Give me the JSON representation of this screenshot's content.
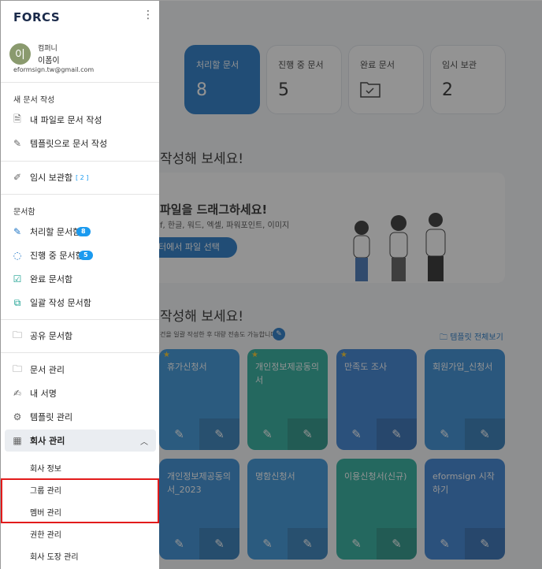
{
  "summary_cards": [
    {
      "label": "처리할 문서",
      "value": "8",
      "active": true
    },
    {
      "label": "진행 중 문서",
      "value": "5",
      "active": false
    },
    {
      "label": "완료 문서",
      "value": "",
      "icon": "folder-check-icon",
      "active": false
    },
    {
      "label": "임시 보관",
      "value": "2",
      "active": false
    }
  ],
  "upload": {
    "heading": "작성해 보세요!",
    "drag_title": "파일을 드래그하세요!",
    "formats": "f, 한글, 워드, 엑셀, 파워포인트, 이미지",
    "button": "터에서 파일 선택"
  },
  "templates": {
    "heading": "작성해 보세요!",
    "note": "건을 일괄 작성한 후 대량 전송도 가능합니다.",
    "view_all": "템플릿 전체보기",
    "cards": [
      {
        "title": "휴가신청서",
        "color": "#2f8fd6",
        "starred": true
      },
      {
        "title": "개인정보제공동의서",
        "color": "#21a897",
        "starred": true
      },
      {
        "title": "만족도 조사",
        "color": "#2e7ad1",
        "starred": true
      },
      {
        "title": "회원가입_신청서",
        "color": "#2c86d3",
        "starred": false
      },
      {
        "title": "개인정보제공동의서_2023",
        "color": "#2c86d3",
        "starred": false
      },
      {
        "title": "명함신청서",
        "color": "#2f8fd6",
        "starred": false
      },
      {
        "title": "이용신청서(신규)",
        "color": "#21a897",
        "starred": false
      },
      {
        "title": "eformsign 시작하기",
        "color": "#2e7ad1",
        "starred": false
      }
    ]
  },
  "drawer": {
    "logo": "FORCS",
    "profile": {
      "initial": "이",
      "company": "컴퍼니",
      "name": "이폼이",
      "email": "eformsign.tw@gmail.com"
    },
    "new_section": "새 문서 작성",
    "new_items": [
      "내 파일로 문서 작성",
      "템플릿으로 문서 작성"
    ],
    "temp": {
      "label": "임시 보관함",
      "count": "[ 2 ]"
    },
    "docs_section": "문서함",
    "doc_items": [
      {
        "label": "처리할 문서함",
        "badge": "8"
      },
      {
        "label": "진행 중 문서함",
        "badge": "5"
      },
      {
        "label": "완료 문서함",
        "badge": ""
      },
      {
        "label": "일괄 작성 문서함",
        "badge": ""
      }
    ],
    "shared": "공유 문서함",
    "manage_items": [
      "문서 관리",
      "내 서명",
      "템플릿 관리"
    ],
    "company_manage": "회사 관리",
    "company_sub": [
      "회사 정보",
      "그룹 관리",
      "멤버 관리",
      "권한 관리",
      "회사 도장 관리"
    ]
  },
  "highlight_color": "#e21b1b"
}
